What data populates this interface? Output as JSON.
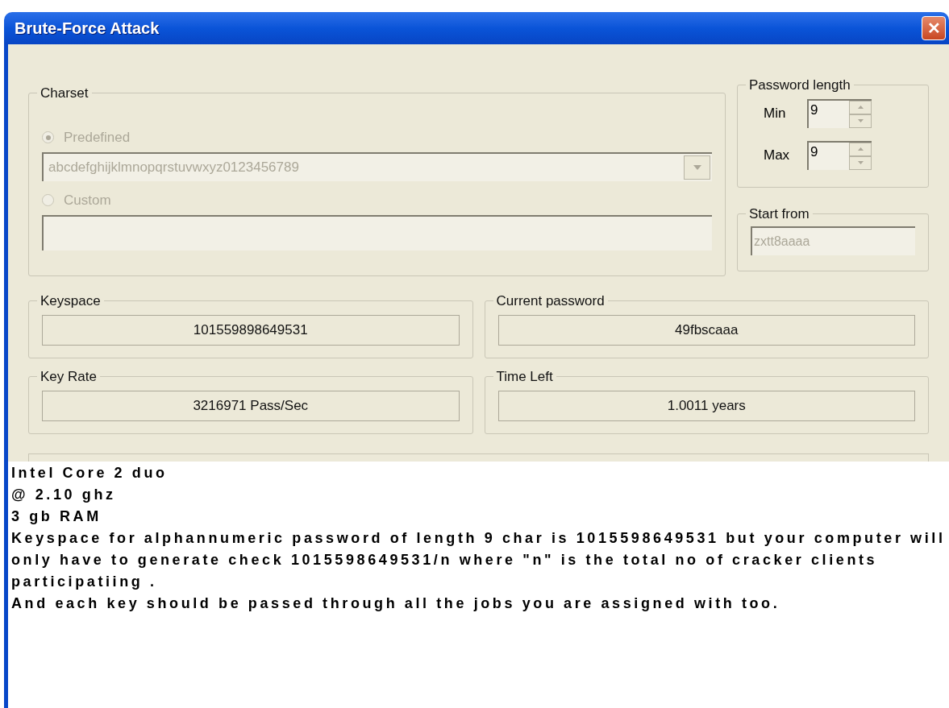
{
  "window": {
    "title": "Brute-Force Attack",
    "close": "✕"
  },
  "charset": {
    "label": "Charset",
    "disabled": true,
    "options": [
      {
        "label": "Predefined",
        "selected": true
      },
      {
        "label": "Custom",
        "selected": false
      }
    ],
    "predefined_value": "abcdefghijklmnopqrstuvwxyz0123456789"
  },
  "password_length": {
    "label": "Password length",
    "fields": [
      {
        "label": "Min",
        "value": "9"
      },
      {
        "label": "Max",
        "value": "9"
      }
    ]
  },
  "start_from": {
    "label": "Start from",
    "value": "zxtt8aaaa",
    "disabled": true
  },
  "stats": [
    {
      "label": "Keyspace",
      "value": "101559898649531"
    },
    {
      "label": "Current password",
      "value": "49fbscaaa"
    },
    {
      "label": "Key Rate",
      "value": "3216971 Pass/Sec"
    },
    {
      "label": "Time Left",
      "value": "1.0011 years"
    }
  ],
  "note": {
    "lines": [
      "Intel Core 2 duo",
      "@ 2.10 ghz",
      "3 gb RAM"
    ],
    "paragraphs": [
      "Keyspace for alphannumeric password of length 9 char is 1015598649531 but your computer will only have to generate check 1015598649531/n where \"n\" is the total no of cracker clients participatiing .",
      "And each key should be passed through all the jobs you are assigned with too."
    ]
  }
}
